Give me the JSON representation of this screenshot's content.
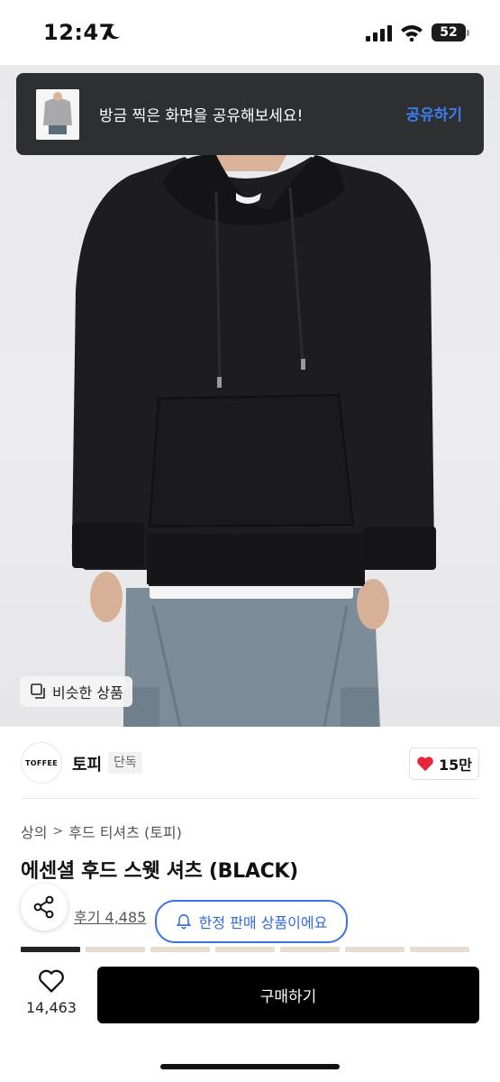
{
  "status_bar": {
    "time": "12:47",
    "battery": "52"
  },
  "toast": {
    "message": "방금 찍은 화면을 공유해보세요!",
    "action_label": "공유하기"
  },
  "hero": {
    "similar_label": "비슷한 상품"
  },
  "seller": {
    "logo_text": "TOFFEE",
    "name": "토피",
    "badge": "단독",
    "likes": "15만"
  },
  "breadcrumb": {
    "category": "상의",
    "separator": ">",
    "subcategory": "후드 티셔츠 (토피)"
  },
  "product": {
    "title": "에센셜 후드 스웻 셔츠 (BLACK)",
    "review_text": "후기 4,485",
    "limited_label": "한정 판매 상품이에요"
  },
  "bottom_bar": {
    "wish_count": "14,463",
    "buy_label": "구매하기"
  },
  "colors": {
    "accent_blue": "#3b72e6",
    "toast_bg": "#2e2f31",
    "heart_red": "#e8253b"
  }
}
